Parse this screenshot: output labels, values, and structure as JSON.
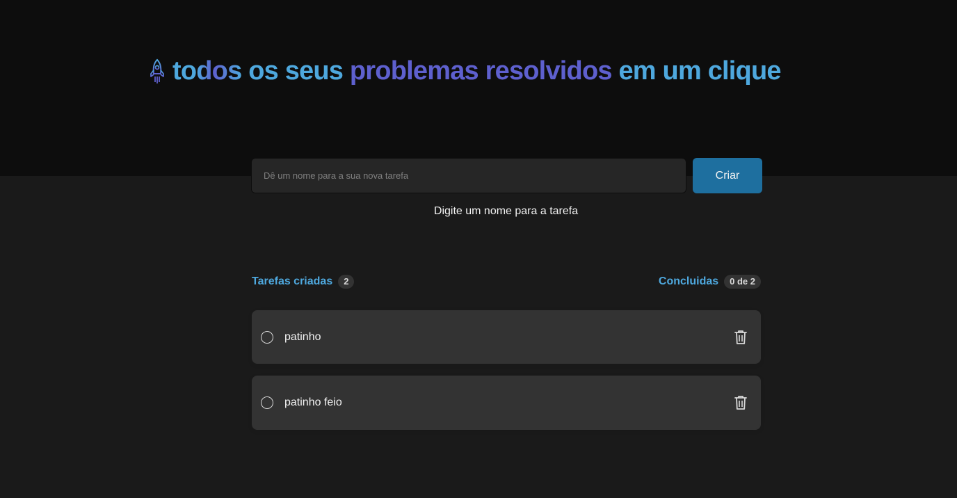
{
  "header": {
    "title_parts": {
      "todos": "todos",
      "os_seus": "os seus",
      "problemas_resolvidos": "problemas resolvidos",
      "em_um_clique": "em um clique"
    },
    "icon": "rocket-icon"
  },
  "form": {
    "input_placeholder": "Dê um nome para a sua nova tarefa",
    "input_value": "",
    "create_label": "Criar",
    "hint": "Digite um nome para a tarefa"
  },
  "counters": {
    "created_label": "Tarefas criadas",
    "created_count": "2",
    "done_label": "Concluidas",
    "done_count": "0 de 2"
  },
  "tasks": [
    {
      "text": "patinho",
      "done": false
    },
    {
      "text": "patinho feio",
      "done": false
    }
  ],
  "colors": {
    "blue": "#4ea8de",
    "purple": "#5e60ce",
    "button": "#1e6f9f",
    "header_bg": "#0d0d0d",
    "body_bg": "#1a1a1a",
    "card_bg": "#333333"
  }
}
